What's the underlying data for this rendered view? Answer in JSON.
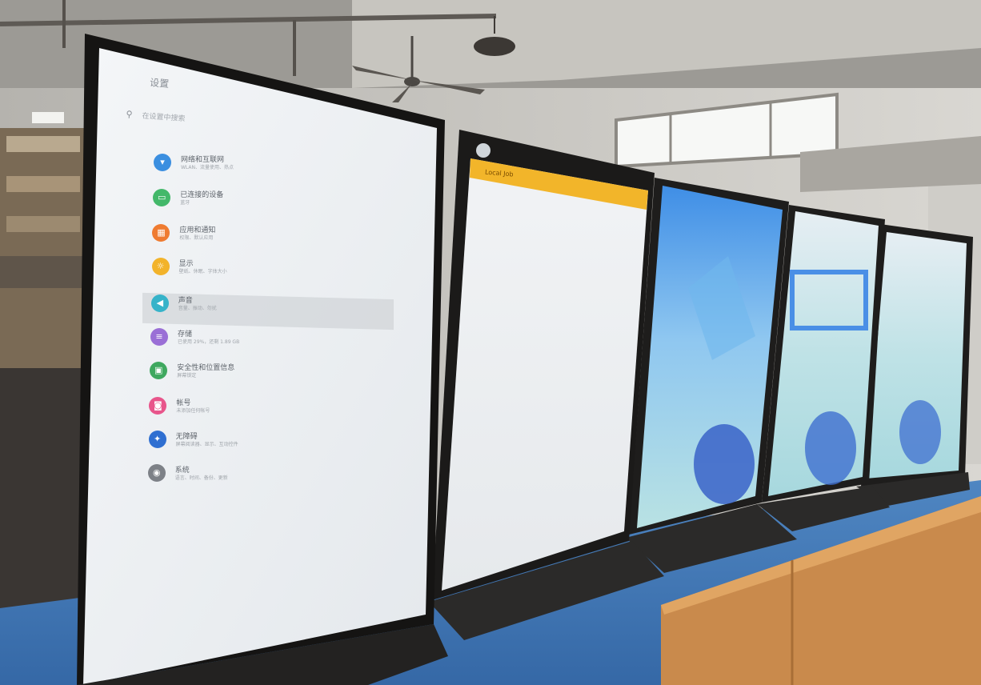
{
  "settings": {
    "title": "设置",
    "search_placeholder": "在设置中搜索",
    "items": [
      {
        "label": "网络和互联网",
        "sub": "WLAN、流量使用、热点",
        "color": "#3b8fe0",
        "icon": "wifi-icon"
      },
      {
        "label": "已连接的设备",
        "sub": "蓝牙",
        "color": "#43b86a",
        "icon": "devices-icon"
      },
      {
        "label": "应用和通知",
        "sub": "权限、默认应用",
        "color": "#ef7b31",
        "icon": "apps-icon"
      },
      {
        "label": "显示",
        "sub": "壁纸、休眠、字体大小",
        "color": "#f2b32b",
        "icon": "display-icon"
      },
      {
        "label": "声音",
        "sub": "音量、振动、勿扰",
        "color": "#36b3c9",
        "icon": "sound-icon"
      },
      {
        "label": "存储",
        "sub": "已使用 29%，还剩 1.89 GB",
        "color": "#9a6fd6",
        "icon": "storage-icon"
      },
      {
        "label": "安全性和位置信息",
        "sub": "屏幕锁定",
        "color": "#3fa85f",
        "icon": "lock-icon"
      },
      {
        "label": "帐号",
        "sub": "未添加任何帐号",
        "color": "#e8558b",
        "icon": "account-icon"
      },
      {
        "label": "无障碍",
        "sub": "屏幕阅读器、显示、互动控件",
        "color": "#2f6fd1",
        "icon": "accessibility-icon"
      },
      {
        "label": "系统",
        "sub": "语言、时间、备份、更新",
        "color": "#7d8187",
        "icon": "system-icon"
      }
    ]
  },
  "second_screen": {
    "bar_text": "Local Job"
  }
}
